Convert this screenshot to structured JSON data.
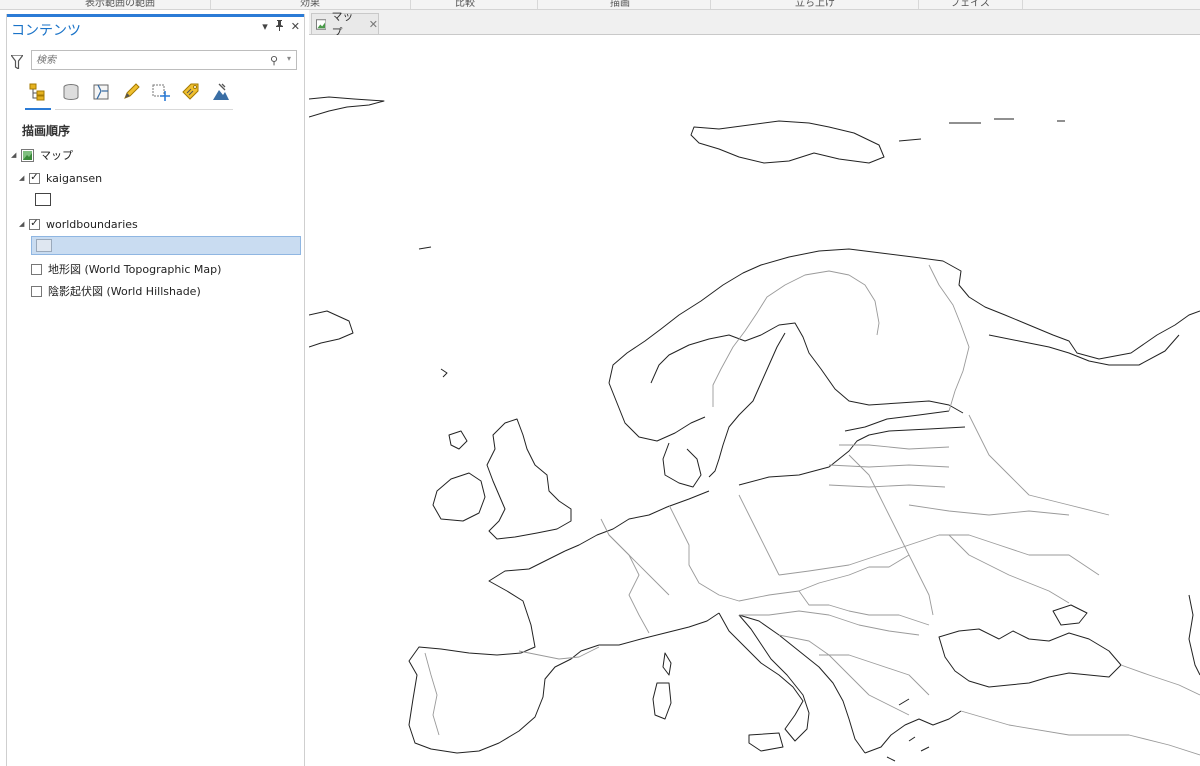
{
  "ribbon": {
    "groups": [
      "表示範囲の範囲",
      "効果",
      "比較",
      "描画",
      "立ち上げ",
      "フェイス"
    ]
  },
  "contents_pane": {
    "title": "コンテンツ",
    "controls": {
      "dropdown": "▾",
      "pin": "🖈",
      "close": "✕"
    },
    "search": {
      "placeholder": "検索"
    },
    "tools": [
      {
        "icon": "draw-order-icon"
      },
      {
        "icon": "data-source-icon"
      },
      {
        "icon": "selection-icon"
      },
      {
        "icon": "editing-icon"
      },
      {
        "icon": "snapping-icon"
      },
      {
        "icon": "labeling-icon"
      },
      {
        "icon": "perspective-imagery-icon"
      }
    ],
    "heading": "描画順序",
    "tree": {
      "map_label": "マップ",
      "layers": [
        {
          "name": "kaigansen",
          "checked": true,
          "expanded": true
        },
        {
          "name": "worldboundaries",
          "checked": true,
          "expanded": true,
          "selected": true
        },
        {
          "name": "地形図 (World Topographic Map)",
          "checked": false
        },
        {
          "name": "陰影起伏図 (World Hillshade)",
          "checked": false
        }
      ]
    }
  },
  "map_view": {
    "tab_label": "マップ",
    "tab_close": "✕"
  },
  "colors": {
    "accent": "#2b7bd6",
    "selection": "#c9dcf1",
    "coastline": "#222222",
    "boundaries": "#9a9a9a"
  }
}
